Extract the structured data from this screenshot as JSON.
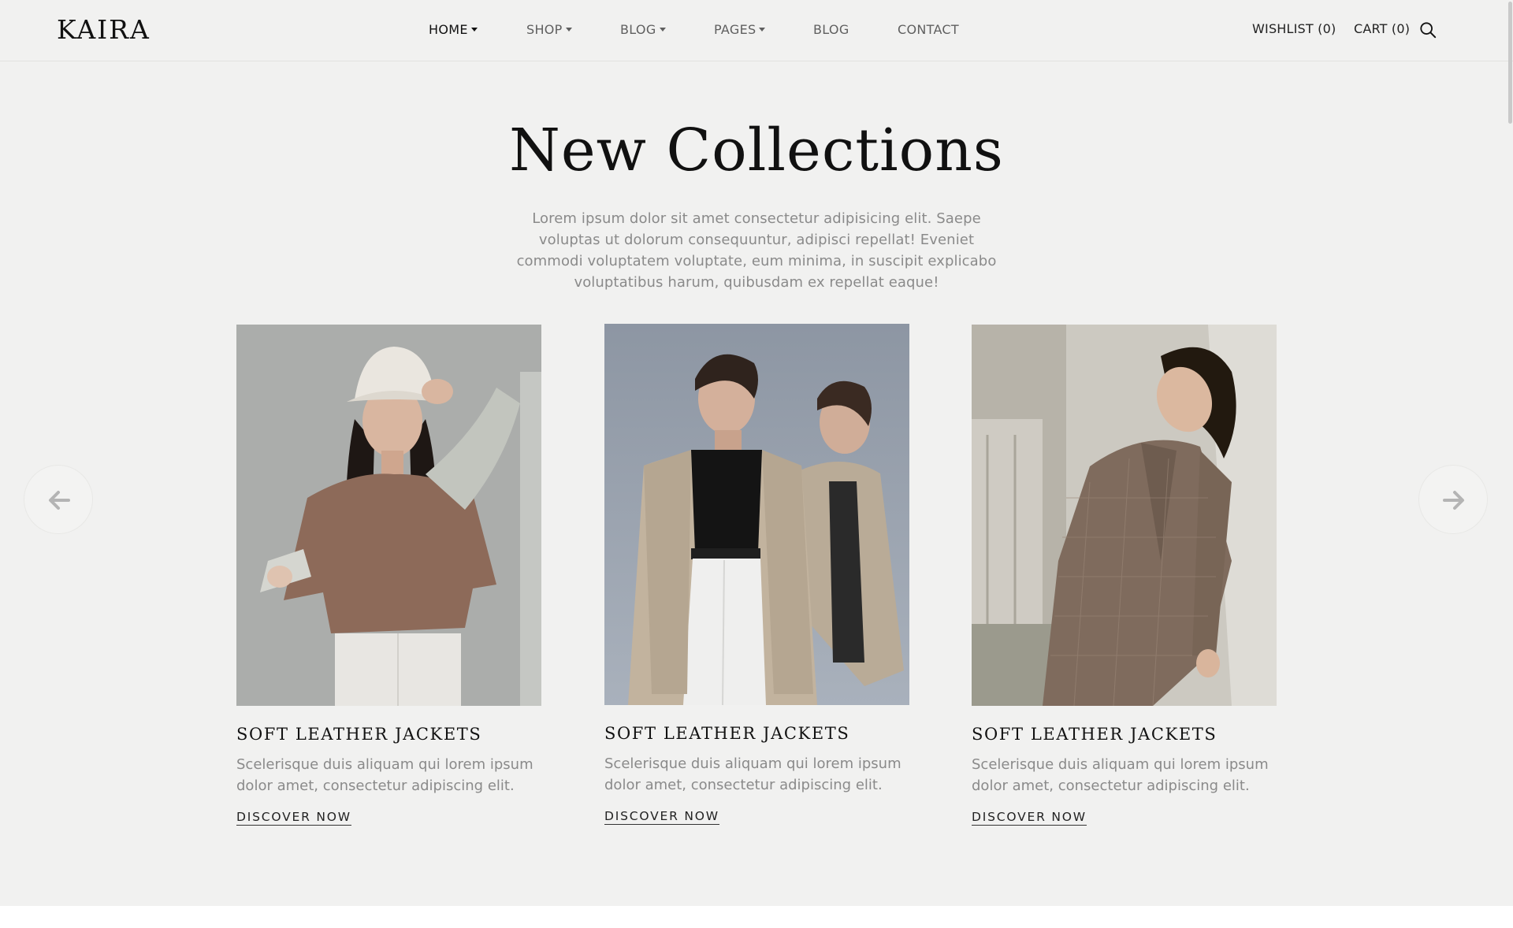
{
  "header": {
    "logo": "KAIRA",
    "nav": [
      {
        "label": "HOME",
        "dropdown": true,
        "active": true
      },
      {
        "label": "SHOP",
        "dropdown": true
      },
      {
        "label": "BLOG",
        "dropdown": true
      },
      {
        "label": "PAGES",
        "dropdown": true
      },
      {
        "label": "BLOG",
        "dropdown": false
      },
      {
        "label": "CONTACT",
        "dropdown": false
      }
    ],
    "wishlist": "WISHLIST (0)",
    "cart": "CART (0)",
    "search_icon": "search-icon"
  },
  "section": {
    "title": "New Collections",
    "description": "Lorem ipsum dolor sit amet consectetur adipisicing elit. Saepe voluptas ut dolorum consequuntur, adipisci repellat! Eveniet commodi voluptatem voluptate, eum minima, in suscipit explicabo voluptatibus harum, quibusdam ex repellat eaque!"
  },
  "carousel": {
    "prev_icon": "arrow-left-icon",
    "next_icon": "arrow-right-icon",
    "items": [
      {
        "title": "SOFT LEATHER JACKETS",
        "description": "Scelerisque duis aliquam qui lorem ipsum dolor amet, consectetur adipiscing elit.",
        "link": "DISCOVER NOW"
      },
      {
        "title": "SOFT LEATHER JACKETS",
        "description": "Scelerisque duis aliquam qui lorem ipsum dolor amet, consectetur adipiscing elit.",
        "link": "DISCOVER NOW"
      },
      {
        "title": "SOFT LEATHER JACKETS",
        "description": "Scelerisque duis aliquam qui lorem ipsum dolor amet, consectetur adipiscing elit.",
        "link": "DISCOVER NOW"
      }
    ]
  },
  "colors": {
    "background": "#f1f1f0",
    "text": "#111111",
    "muted": "#8a8a8a"
  }
}
